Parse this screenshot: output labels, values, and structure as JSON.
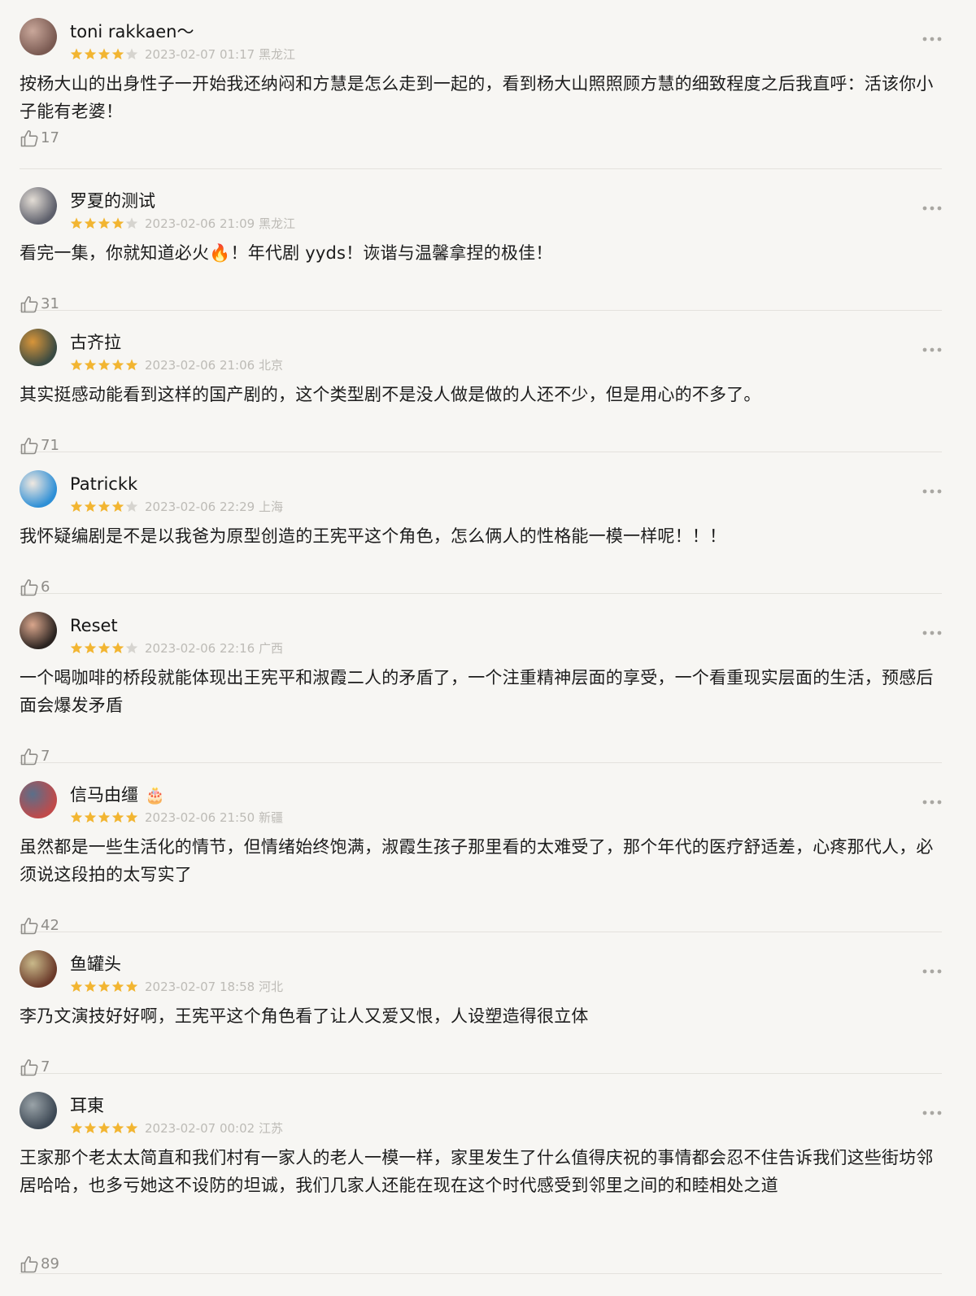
{
  "reviews": [
    {
      "user": "toni rakkaen～",
      "rating": 4,
      "date": "2023-02-07 01:17",
      "location": "黑龙江",
      "text": "按杨大山的出身性子一开始我还纳闷和方慧是怎么走到一起的，看到杨大山照照顾方慧的细致程度之后我直呼：活该你小子能有老婆！",
      "likes": "17",
      "avatar_colors": [
        "#7a5a52",
        "#c9a79a"
      ]
    },
    {
      "user": "罗夏的测试",
      "rating": 4,
      "date": "2023-02-06 21:09",
      "location": "黑龙江",
      "text": "看完一集，你就知道必火🔥！年代剧 yyds！诙谐与温馨拿捏的极佳！",
      "likes": "31",
      "avatar_colors": [
        "#5d5f6b",
        "#e3ddd5"
      ]
    },
    {
      "user": "古齐拉",
      "rating": 5,
      "date": "2023-02-06 21:06",
      "location": "北京",
      "text": "其实挺感动能看到这样的国产剧的，这个类型剧不是没人做是做的人还不少，但是用心的不多了。",
      "likes": "71",
      "avatar_colors": [
        "#3a4a42",
        "#d8953a"
      ]
    },
    {
      "user": "Patrickk",
      "rating": 4,
      "date": "2023-02-06 22:29",
      "location": "上海",
      "text": "我怀疑编剧是不是以我爸为原型创造的王宪平这个角色，怎么俩人的性格能一模一样呢！！！",
      "likes": "6",
      "avatar_colors": [
        "#2e8fd6",
        "#f0e8e0"
      ]
    },
    {
      "user": "Reset",
      "rating": 4,
      "date": "2023-02-06 22:16",
      "location": "广西",
      "text": "一个喝咖啡的桥段就能体现出王宪平和淑霞二人的矛盾了，一个注重精神层面的享受，一个看重现实层面的生活，预感后面会爆发矛盾",
      "likes": "7",
      "avatar_colors": [
        "#2a2320",
        "#d9a68c"
      ]
    },
    {
      "user": "信马由缰",
      "badge": "🎂",
      "rating": 5,
      "date": "2023-02-06 21:50",
      "location": "新疆",
      "text": "虽然都是一些生活化的情节，但情绪始终饱满，淑霞生孩子那里看的太难受了，那个年代的医疗舒适差，心疼那代人，必须说这段拍的太写实了",
      "likes": "42",
      "avatar_colors": [
        "#c04a4a",
        "#5a6f8a"
      ]
    },
    {
      "user": "鱼罐头",
      "rating": 5,
      "date": "2023-02-07 18:58",
      "location": "河北",
      "text": "李乃文演技好好啊，王宪平这个角色看了让人又爱又恨，人设塑造得很立体",
      "likes": "7",
      "avatar_colors": [
        "#6b3a2a",
        "#c9b98a"
      ]
    },
    {
      "user": "耳東",
      "rating": 5,
      "date": "2023-02-07 00:02",
      "location": "江苏",
      "text": "王家那个老太太简直和我们村有一家人的老人一模一样，家里发生了什么值得庆祝的事情都会忍不住告诉我们这些街坊邻居哈哈，也多亏她这不设防的坦诚，我们几家人还能在现在这个时代感受到邻里之间的和睦相处之道",
      "likes": "89",
      "avatar_colors": [
        "#3d4854",
        "#9aa3a8"
      ]
    }
  ],
  "colors": {
    "star_filled": "#f2b531",
    "star_empty": "#d6d4cf",
    "meta_text": "#bdbbb6",
    "background": "#f7f6f3"
  },
  "icons": {
    "like": "thumbs-up-icon",
    "more": "more-dots-icon"
  }
}
